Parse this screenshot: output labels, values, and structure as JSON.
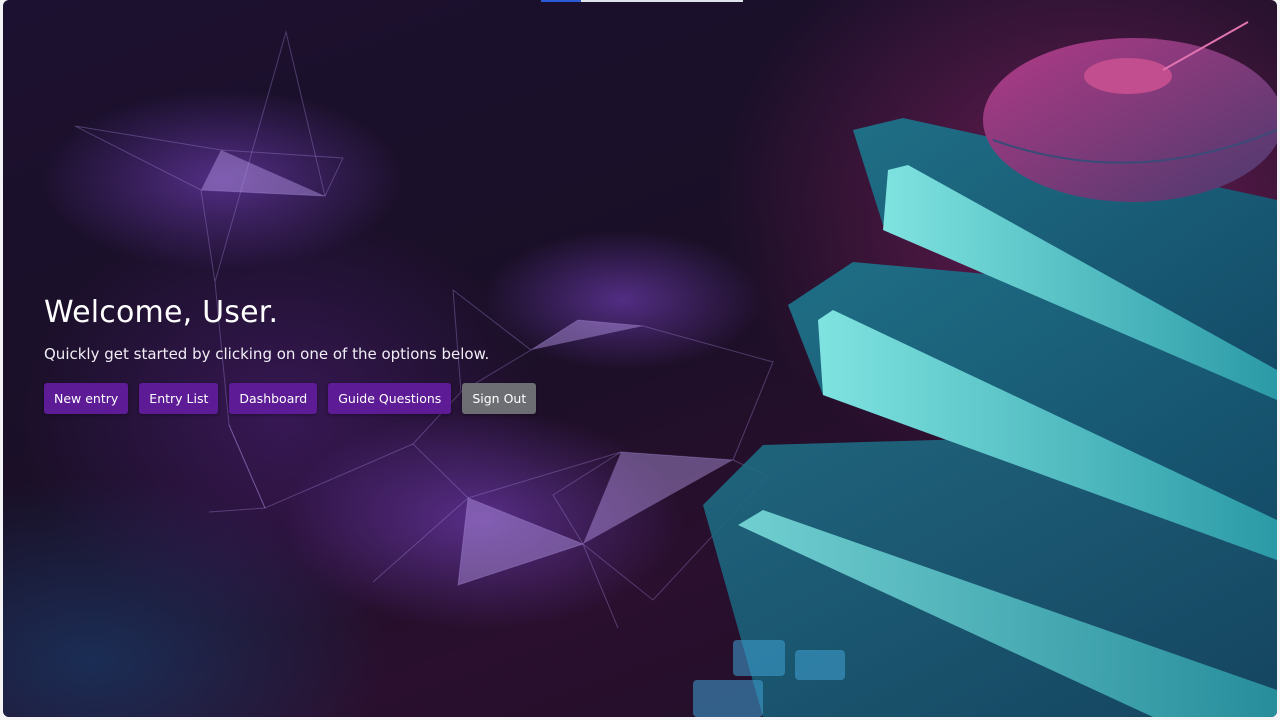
{
  "hero": {
    "title": "Welcome, User.",
    "subtitle": "Quickly get started by clicking on one of the options below."
  },
  "actions": [
    {
      "label": "New entry",
      "style": "primary"
    },
    {
      "label": "Entry List",
      "style": "primary"
    },
    {
      "label": "Dashboard",
      "style": "primary"
    },
    {
      "label": "Guide Questions",
      "style": "primary"
    },
    {
      "label": "Sign Out",
      "style": "secondary"
    }
  ],
  "background": {
    "icon": "books-and-mouse-photo-icon"
  },
  "colors": {
    "primary_button": "#5d1b96",
    "secondary_button": "#6c6e73",
    "accent_pink": "#a8286f",
    "accent_teal": "#2fb3b8"
  }
}
